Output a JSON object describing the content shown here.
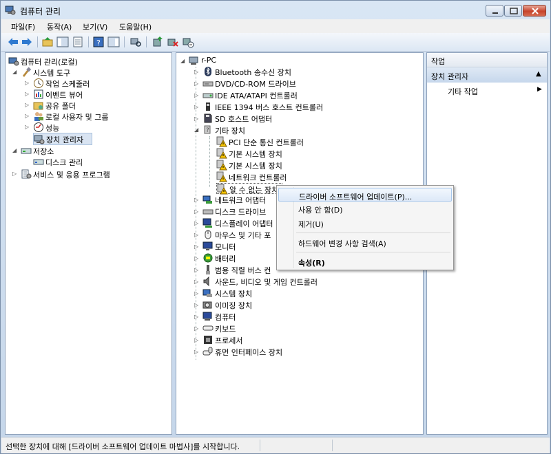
{
  "window": {
    "title": "컴퓨터 관리"
  },
  "menu": [
    "파일(F)",
    "동작(A)",
    "보기(V)",
    "도움말(H)"
  ],
  "left_tree": {
    "root": "컴퓨터 관리(로컬)",
    "system_tools": "시스템 도구",
    "task_scheduler": "작업 스케줄러",
    "event_viewer": "이벤트 뷰어",
    "shared_folders": "공유 폴더",
    "local_users": "로컬 사용자 및 그룹",
    "performance": "성능",
    "device_manager": "장치 관리자",
    "storage": "저장소",
    "disk_management": "디스크 관리",
    "services_apps": "서비스 및 응용 프로그램"
  },
  "device_tree": {
    "root": "r-PC",
    "categories_top": [
      "Bluetooth 송수신 장치",
      "DVD/CD-ROM 드라이브",
      "IDE ATA/ATAPI 컨트롤러",
      "IEEE 1394 버스 호스트 컨트롤러",
      "SD 호스트 어댑터"
    ],
    "other_devices": "기타 장치",
    "other_children": [
      "PCI 단순 통신 컨트롤러",
      "기본 시스템 장치",
      "기본 시스템 장치",
      "네트워크 컨트롤러",
      "알 수 없는 장치"
    ],
    "categories_bottom": [
      "네트워크 어댑터",
      "디스크 드라이브",
      "디스플레이 어댑터",
      "마우스 및 기타 포",
      "모니터",
      "배터리",
      "범용 직렬 버스 컨",
      "사운드, 비디오 및 게임 컨트롤러",
      "시스템 장치",
      "이미징 장치",
      "컴퓨터",
      "키보드",
      "프로세서",
      "휴먼 인터페이스 장치"
    ]
  },
  "actions": {
    "header": "작업",
    "section": "장치 관리자",
    "item": "기타 작업"
  },
  "context_menu": {
    "update_driver": "드라이버 소프트웨어 업데이트(P)...",
    "disable": "사용 안 함(D)",
    "uninstall": "제거(U)",
    "scan": "하드웨어 변경 사항 검색(A)",
    "properties": "속성(R)"
  },
  "status": {
    "text": "선택한 장치에 대해 [드라이버 소프트웨어 업데이트 마법사]를 시작합니다."
  }
}
